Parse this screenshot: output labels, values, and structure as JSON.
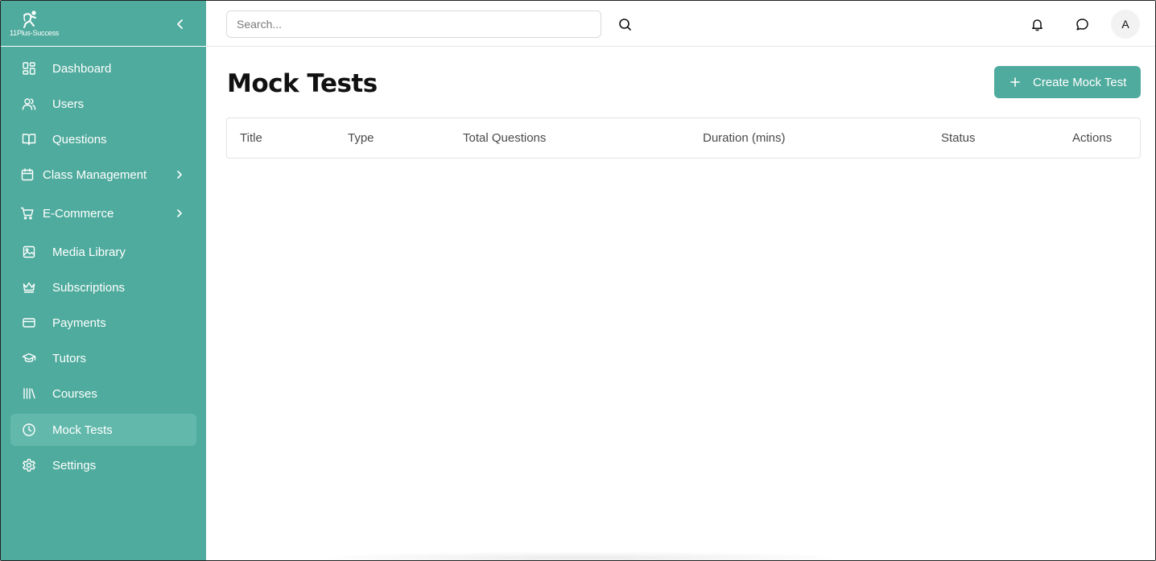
{
  "brand": {
    "logo_text": "11Plus-Success"
  },
  "colors": {
    "sidebar": "#4fab9d",
    "active_item": "#62b8ab",
    "accent": "#4fab9d"
  },
  "sidebar": {
    "items": [
      {
        "label": "Dashboard",
        "icon": "dashboard-icon"
      },
      {
        "label": "Users",
        "icon": "users-icon"
      },
      {
        "label": "Questions",
        "icon": "book-open-icon"
      },
      {
        "label": "Class Management",
        "icon": "calendar-icon",
        "expandable": true
      },
      {
        "label": "E-Commerce",
        "icon": "cart-icon",
        "expandable": true
      },
      {
        "label": "Media Library",
        "icon": "image-icon"
      },
      {
        "label": "Subscriptions",
        "icon": "crown-icon"
      },
      {
        "label": "Payments",
        "icon": "credit-card-icon"
      },
      {
        "label": "Tutors",
        "icon": "graduation-cap-icon"
      },
      {
        "label": "Courses",
        "icon": "library-icon"
      },
      {
        "label": "Mock Tests",
        "icon": "clock-icon",
        "active": true
      },
      {
        "label": "Settings",
        "icon": "gear-icon"
      }
    ]
  },
  "header": {
    "search_placeholder": "Search...",
    "avatar_initial": "A"
  },
  "main": {
    "title": "Mock Tests",
    "create_button": "Create Mock Test",
    "table": {
      "columns": [
        "Title",
        "Type",
        "Total Questions",
        "Duration (mins)",
        "Status",
        "Actions"
      ],
      "rows": []
    }
  }
}
